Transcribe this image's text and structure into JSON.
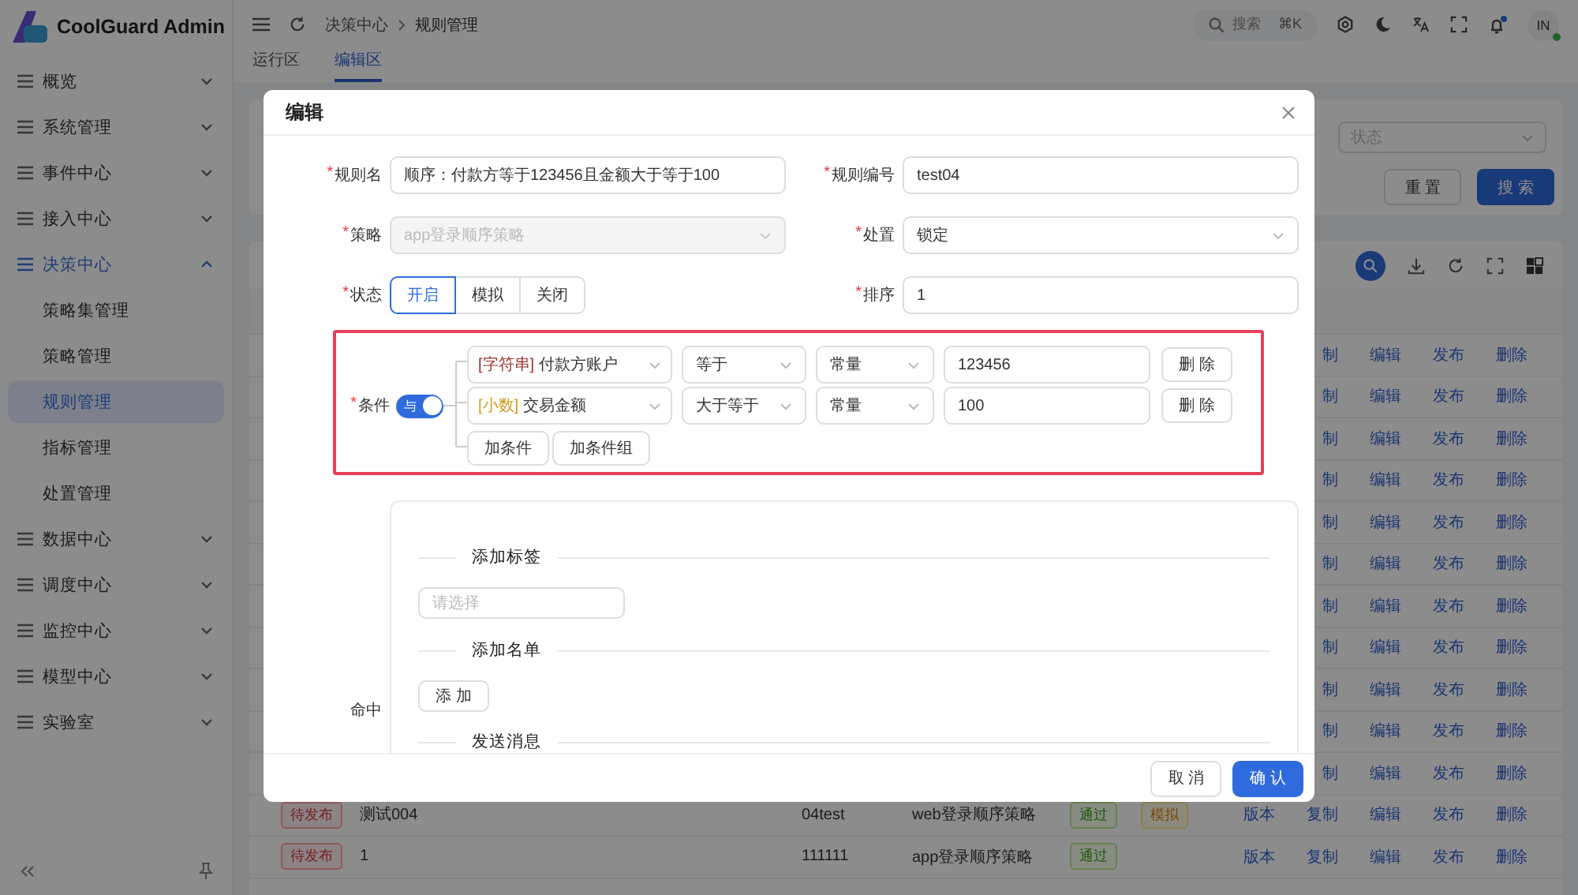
{
  "sidebar": {
    "title": "CoolGuard Admin",
    "items": [
      {
        "label": "概览",
        "expanded": false
      },
      {
        "label": "系统管理",
        "expanded": false
      },
      {
        "label": "事件中心",
        "expanded": false
      },
      {
        "label": "接入中心",
        "expanded": false
      },
      {
        "label": "决策中心",
        "expanded": true,
        "children": [
          {
            "label": "策略集管理",
            "selected": false
          },
          {
            "label": "策略管理",
            "selected": false
          },
          {
            "label": "规则管理",
            "selected": true
          },
          {
            "label": "指标管理",
            "selected": false
          },
          {
            "label": "处置管理",
            "selected": false
          }
        ]
      },
      {
        "label": "数据中心",
        "expanded": false
      },
      {
        "label": "调度中心",
        "expanded": false
      },
      {
        "label": "监控中心",
        "expanded": false
      },
      {
        "label": "模型中心",
        "expanded": false
      },
      {
        "label": "实验室",
        "expanded": false
      }
    ]
  },
  "header": {
    "breadcrumb": [
      "决策中心",
      "规则管理"
    ],
    "search": {
      "label": "搜索",
      "shortcut": "⌘K"
    },
    "avatar": "IN"
  },
  "tabs": [
    {
      "label": "运行区",
      "selected": false
    },
    {
      "label": "编辑区",
      "selected": true
    }
  ],
  "filter": {
    "status_select": {
      "placeholder": "状态"
    },
    "buttons": [
      {
        "label": "重 置",
        "kind": "default"
      },
      {
        "label": "搜 索",
        "kind": "primary"
      }
    ]
  },
  "table": {
    "rows": [
      {
        "actions": [
          "制",
          "编辑",
          "发布",
          "删除"
        ]
      },
      {
        "actions": [
          "制",
          "编辑",
          "发布",
          "删除"
        ]
      },
      {
        "actions": [
          "制",
          "编辑",
          "发布",
          "删除"
        ]
      },
      {
        "actions": [
          "制",
          "编辑",
          "发布",
          "删除"
        ]
      },
      {
        "actions": [
          "制",
          "编辑",
          "发布",
          "删除"
        ]
      },
      {
        "actions": [
          "制",
          "编辑",
          "发布",
          "删除"
        ]
      },
      {
        "actions": [
          "制",
          "编辑",
          "发布",
          "删除"
        ]
      },
      {
        "actions": [
          "制",
          "编辑",
          "发布",
          "删除"
        ]
      },
      {
        "actions": [
          "制",
          "编辑",
          "发布",
          "删除"
        ]
      },
      {
        "actions": [
          "制",
          "编辑",
          "发布",
          "删除"
        ]
      },
      {
        "actions": [
          "制",
          "编辑",
          "发布",
          "删除"
        ]
      },
      {
        "status": "待发布",
        "name": "测试004",
        "code": "04test",
        "strategy": "web登录顺序策略",
        "result": "通过",
        "mode": "模拟",
        "actions": [
          "版本",
          "复制",
          "编辑",
          "发布",
          "删除"
        ]
      },
      {
        "status": "待发布",
        "name": "1",
        "code": "111111",
        "strategy": "app登录顺序策略",
        "result": "通过",
        "actions": [
          "版本",
          "复制",
          "编辑",
          "发布",
          "删除"
        ]
      }
    ]
  },
  "modal": {
    "title": "编辑",
    "fields": [
      {
        "label": "规则名",
        "required_mark": "*",
        "kind": "text",
        "value": "顺序：付款方等于123456且金额大于等于100"
      },
      {
        "label": "规则编号",
        "required_mark": "*",
        "kind": "text",
        "value": "test04"
      },
      {
        "label": "策略",
        "required_mark": "*",
        "kind": "select",
        "value": "app登录顺序策略",
        "disabled": true
      },
      {
        "label": "处置",
        "required_mark": "*",
        "kind": "select",
        "value": "锁定",
        "disabled": false
      },
      {
        "label": "状态",
        "required_mark": "*",
        "kind": "segmented",
        "options": [
          {
            "label": "开启",
            "selected": true
          },
          {
            "label": "模拟",
            "selected": false
          },
          {
            "label": "关闭",
            "selected": false
          }
        ]
      },
      {
        "label": "排序",
        "required_mark": "*",
        "kind": "text",
        "value": "1"
      }
    ],
    "conditions": {
      "label": "条件",
      "required_mark": "*",
      "logic": {
        "label": "与",
        "on": true
      },
      "rows": [
        {
          "type_tag": "[字符串]",
          "color": "#9a2f2a",
          "field": "付款方账户",
          "operator": "等于",
          "value_type": "常量",
          "value": "123456",
          "delete": "删 除"
        },
        {
          "type_tag": "[小数]",
          "color": "#d49a1c",
          "field": "交易金额",
          "operator": "大于等于",
          "value_type": "常量",
          "value": "100",
          "delete": "删 除"
        }
      ],
      "buttons": [
        "加条件",
        "加条件组"
      ]
    },
    "hit": {
      "label": "命中",
      "sections": [
        {
          "title": "添加标签",
          "kind": "select",
          "placeholder": "请选择"
        },
        {
          "title": "添加名单",
          "kind": "button",
          "button": "添 加"
        },
        {
          "title": "发送消息"
        }
      ]
    },
    "footer": {
      "buttons": [
        {
          "label": "取 消",
          "kind": "default"
        },
        {
          "label": "确 认",
          "kind": "primary"
        }
      ]
    }
  }
}
